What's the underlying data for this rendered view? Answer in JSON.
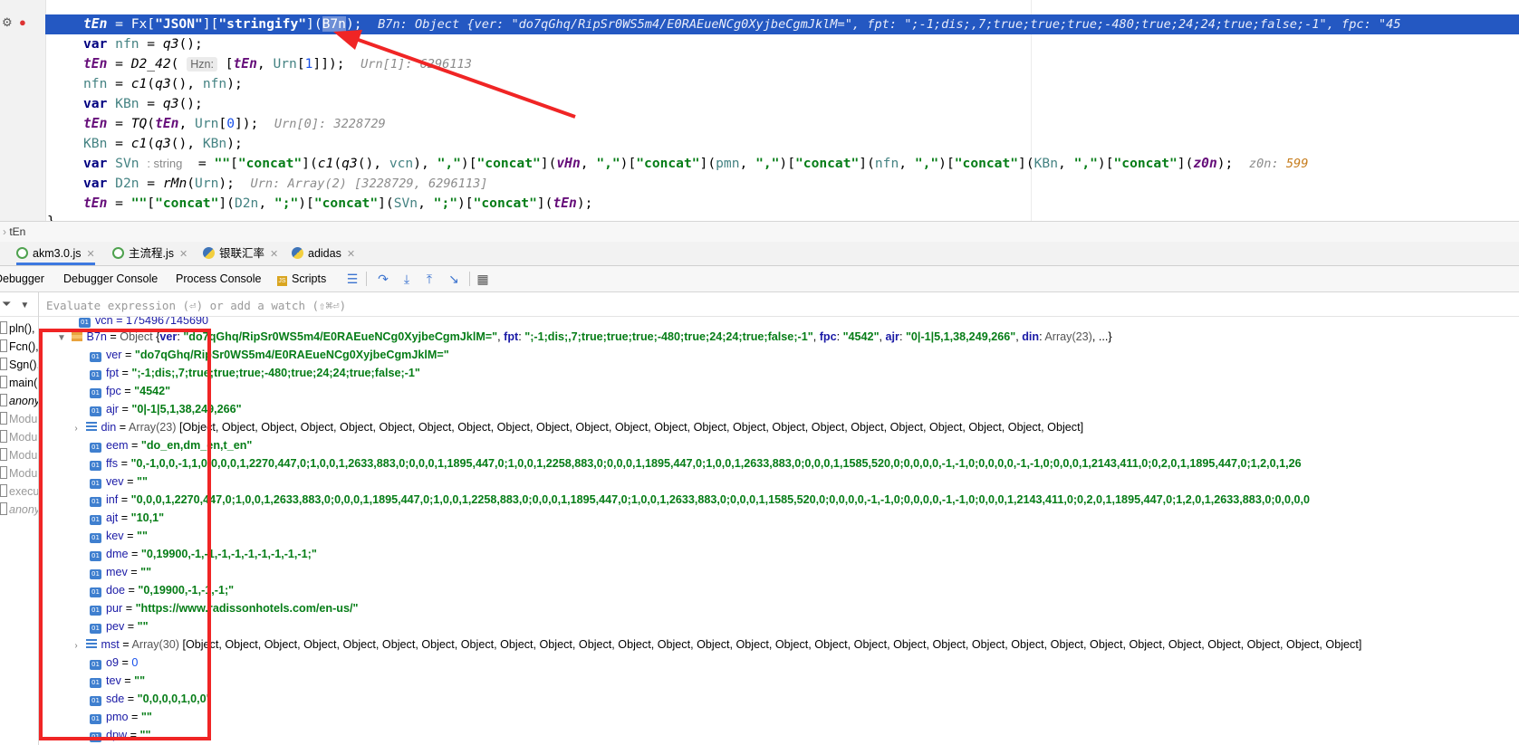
{
  "editor": {
    "lines": [
      {
        "inline": "B7n: Object {ver: \"do7qGhq/RipSr0WS5m4/E0RAEueNCg0XyjbeCgmJklM=\", fpt: \";-1;dis;,7;true;true;true;-480;true;24;24;true;false;-1\", fpc: \"45"
      },
      {},
      {
        "hint": "Hzn:",
        "inline": "Urn[1]: 6296113"
      },
      {},
      {},
      {
        "inline": "Urn[0]: 3228729"
      },
      {},
      {
        "typehint": ": string",
        "inline_label": "z0n:",
        "inline_value": "599"
      },
      {
        "inline": "Urn: Array(2) [3228729, 6296113]"
      },
      {}
    ],
    "closing": "}"
  },
  "breadcrumb": "tEn",
  "file_tabs": [
    {
      "label": "akm3.0.js",
      "icon": "js-file-icon"
    },
    {
      "label": "主流程.js",
      "icon": "js-file-icon"
    },
    {
      "label": "银联汇率",
      "icon": "python-file-icon"
    },
    {
      "label": "adidas",
      "icon": "python-file-icon"
    }
  ],
  "debugger": {
    "tabs": [
      "Debugger",
      "Debugger Console",
      "Process Console",
      "Scripts"
    ],
    "eval_placeholder": "Evaluate expression (⏎) or add a watch (⇧⌘⏎)"
  },
  "frames": [
    "pln(),",
    "Fcn(),",
    "Sgn(),",
    "main(",
    "anony",
    "Modu",
    "Modu",
    "Modu",
    "Modu",
    "execu",
    "anony"
  ],
  "variables": {
    "partial_top": "vcn = 1754967145690",
    "root": {
      "name": "B7n",
      "type": "Object",
      "preview_open": "{",
      "preview": [
        {
          "k": "ver",
          "v": "\"do7qGhq/RipSr0WS5m4/E0RAEueNCg0XyjbeCgmJklM=\""
        },
        {
          "k": "fpt",
          "v": "\";-1;dis;,7;true;true;true;-480;true;24;24;true;false;-1\""
        },
        {
          "k": "fpc",
          "v": "\"4542\""
        },
        {
          "k": "ajr",
          "v": "\"0|-1|5,1,38,249,266\""
        },
        {
          "k": "din",
          "v": "Array(23)"
        }
      ],
      "preview_close": ", ...}"
    },
    "items": [
      {
        "name": "ver",
        "value": "\"do7qGhq/RipSr0WS5m4/E0RAEueNCg0XyjbeCgmJklM=\""
      },
      {
        "name": "fpt",
        "value": "\";-1;dis;,7;true;true;true;-480;true;24;24;true;false;-1\""
      },
      {
        "name": "fpc",
        "value": "\"4542\""
      },
      {
        "name": "ajr",
        "value": "\"0|-1|5,1,38,249,266\""
      },
      {
        "name": "din",
        "type": "Array(23)",
        "value": "[Object, Object, Object, Object, Object, Object, Object, Object, Object, Object, Object, Object, Object, Object, Object, Object, Object, Object, Object, Object, Object, Object, Object]",
        "expandable": true
      },
      {
        "name": "eem",
        "value": "\"do_en,dm_en,t_en\""
      },
      {
        "name": "ffs",
        "value": "\"0,-1,0,0,-1,1,0;0,0,0,1,2270,447,0;1,0,0,1,2633,883,0;0,0,0,1,1895,447,0;1,0,0,1,2258,883,0;0,0,0,1,1895,447,0;1,0,0,1,2633,883,0;0,0,0,1,1585,520,0;0,0,0,0,-1,-1,0;0,0,0,0,-1,-1,0;0,0,0,1,2143,411,0;0,2,0,1,1895,447,0;1,2,0,1,26"
      },
      {
        "name": "vev",
        "value": "\"\""
      },
      {
        "name": "inf",
        "value": "\"0,0,0,1,2270,447,0;1,0,0,1,2633,883,0;0,0,0,1,1895,447,0;1,0,0,1,2258,883,0;0,0,0,1,1895,447,0;1,0,0,1,2633,883,0;0,0,0,1,1585,520,0;0,0,0,0,-1,-1,0;0,0,0,0,-1,-1,0;0,0,0,1,2143,411,0;0,2,0,1,1895,447,0;1,2,0,1,2633,883,0;0,0,0,0"
      },
      {
        "name": "ajt",
        "value": "\"10,1\""
      },
      {
        "name": "kev",
        "value": "\"\""
      },
      {
        "name": "dme",
        "value": "\"0,19900,-1,-1,-1,-1,-1,-1,-1,-1,-1;\""
      },
      {
        "name": "mev",
        "value": "\"\""
      },
      {
        "name": "doe",
        "value": "\"0,19900,-1,-1,-1;\""
      },
      {
        "name": "pur",
        "value": "\"https://www.radissonhotels.com/en-us/\""
      },
      {
        "name": "pev",
        "value": "\"\""
      },
      {
        "name": "mst",
        "type": "Array(30)",
        "value": "[Object, Object, Object, Object, Object, Object, Object, Object, Object, Object, Object, Object, Object, Object, Object, Object, Object, Object, Object, Object, Object, Object, Object, Object, Object, Object, Object, Object, Object, Object]",
        "expandable": true
      },
      {
        "name": "o9",
        "value": "0",
        "numeric": true
      },
      {
        "name": "tev",
        "value": "\"\""
      },
      {
        "name": "sde",
        "value": "\"0,0,0,0,1,0,0\""
      },
      {
        "name": "pmo",
        "value": "\"\""
      },
      {
        "name": "dpw",
        "value": "\"\""
      }
    ]
  },
  "annotation_colors": {
    "red": "#f02525",
    "selection": "#2458c2"
  }
}
